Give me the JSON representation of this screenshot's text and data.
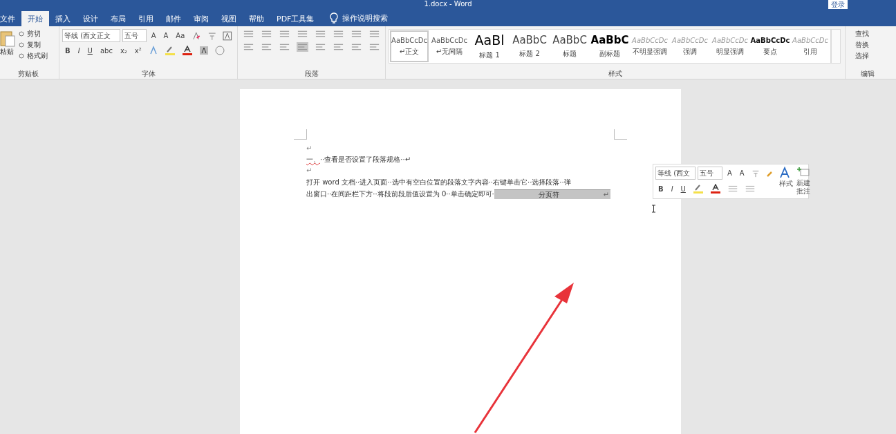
{
  "title_bar": {
    "title": "1.docx - Word",
    "account_button": "登录"
  },
  "tabs": [
    {
      "label": "文件",
      "selected": false
    },
    {
      "label": "开始",
      "selected": true
    },
    {
      "label": "插入",
      "selected": false
    },
    {
      "label": "设计",
      "selected": false
    },
    {
      "label": "布局",
      "selected": false
    },
    {
      "label": "引用",
      "selected": false
    },
    {
      "label": "邮件",
      "selected": false
    },
    {
      "label": "审阅",
      "selected": false
    },
    {
      "label": "视图",
      "selected": false
    },
    {
      "label": "帮助",
      "selected": false
    },
    {
      "label": "PDF工具集",
      "selected": false
    }
  ],
  "tell_me": "操作说明搜索",
  "clipboard": {
    "paste": "粘贴",
    "items": [
      "剪切",
      "复制",
      "格式刷"
    ],
    "label": "剪贴板"
  },
  "font": {
    "font_name": "等线 (西文正文",
    "font_size": "五号",
    "row1": [
      "A",
      "A",
      "Aa"
    ],
    "row2": [
      "B",
      "I",
      "U",
      "abc",
      "x₂",
      "x²"
    ],
    "label": "字体"
  },
  "paragraph": {
    "label": "段落"
  },
  "styles": {
    "label": "样式",
    "items": [
      {
        "preview": "AaBbCcDc",
        "name": "↵正文",
        "kind": "normal",
        "selected": true
      },
      {
        "preview": "AaBbCcDc",
        "name": "↵无间隔",
        "kind": "normal",
        "selected": false
      },
      {
        "preview": "AaBl",
        "name": "标题 1",
        "kind": "heading1",
        "selected": false
      },
      {
        "preview": "AaBbC",
        "name": "标题 2",
        "kind": "heading2",
        "selected": false
      },
      {
        "preview": "AaBbC",
        "name": "标题",
        "kind": "heading2",
        "selected": false
      },
      {
        "preview": "AaBbC",
        "name": "副标题",
        "kind": "subtitle",
        "selected": false
      },
      {
        "preview": "AaBbCcDc",
        "name": "不明显强调",
        "kind": "subtle",
        "selected": false
      },
      {
        "preview": "AaBbCcDc",
        "name": "强调",
        "kind": "subtle",
        "selected": false
      },
      {
        "preview": "AaBbCcDc",
        "name": "明显强调",
        "kind": "subtle",
        "selected": false
      },
      {
        "preview": "AaBbCcDc",
        "name": "要点",
        "kind": "strong",
        "selected": false
      },
      {
        "preview": "AaBbCcDc",
        "name": "引用",
        "kind": "subtle",
        "selected": false
      }
    ]
  },
  "editing": {
    "items": [
      "查找",
      "替换",
      "选择"
    ],
    "label": "编辑"
  },
  "document": {
    "paragraphs": [
      {
        "kind": "empty",
        "text": "↵"
      },
      {
        "kind": "heading",
        "number": "一、",
        "text": "··查看是否设置了段落规格··↵"
      },
      {
        "kind": "empty",
        "text": "↵"
      },
      {
        "kind": "body",
        "lines": [
          "打开 word 文档··进入页面··选中有空白位置的段落文字内容··右键单击它··选择段落··弹",
          "出窗口··在间距栏下方··将段前段后值设置为 0··单击确定即可·"
        ],
        "page_break": "分页符",
        "end": "↵"
      }
    ]
  },
  "mini_toolbar": {
    "font_name": "等线 (西文",
    "font_size": "五号",
    "row1": [
      "A",
      "A"
    ],
    "row2": [
      "B",
      "I",
      "U"
    ],
    "styles": "样式",
    "comment": "新建批注"
  }
}
